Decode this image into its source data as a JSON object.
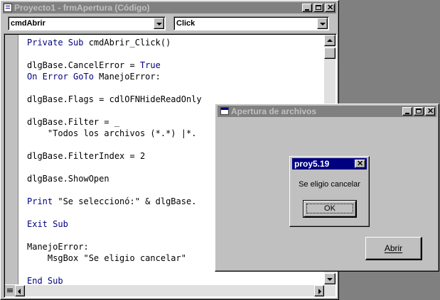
{
  "editor": {
    "title": "Proyecto1 - frmApertura (Código)",
    "object_combo": "cmdAbrir",
    "proc_combo": "Click",
    "lines": [
      [
        {
          "k": "kw",
          "t": "Private Sub "
        },
        {
          "k": "tx",
          "t": "cmdAbrir_Click()"
        }
      ],
      [],
      [
        {
          "k": "tx",
          "t": "dlgBase.CancelError = "
        },
        {
          "k": "kw",
          "t": "True"
        }
      ],
      [
        {
          "k": "kw",
          "t": "On Error GoTo "
        },
        {
          "k": "tx",
          "t": "ManejoError:"
        }
      ],
      [],
      [
        {
          "k": "tx",
          "t": "dlgBase.Flags = cdlOFNHideReadOnly"
        }
      ],
      [],
      [
        {
          "k": "tx",
          "t": "dlgBase.Filter = _"
        }
      ],
      [
        {
          "k": "tx",
          "t": "    \"Todos los archivos (*.*) |*."
        }
      ],
      [],
      [
        {
          "k": "tx",
          "t": "dlgBase.FilterIndex = 2"
        }
      ],
      [],
      [
        {
          "k": "tx",
          "t": "dlgBase.ShowOpen"
        }
      ],
      [],
      [
        {
          "k": "kw",
          "t": "Print "
        },
        {
          "k": "tx",
          "t": "\"Se seleccionó:\" & dlgBase."
        }
      ],
      [],
      [
        {
          "k": "kw",
          "t": "Exit Sub"
        }
      ],
      [],
      [
        {
          "k": "tx",
          "t": "ManejoError:"
        }
      ],
      [
        {
          "k": "tx",
          "t": "    MsgBox \"Se eligio cancelar\""
        }
      ],
      [],
      [
        {
          "k": "kw",
          "t": "End Sub"
        }
      ]
    ]
  },
  "form": {
    "title": "Apertura de archivos",
    "button_label": "Abrir"
  },
  "msgbox": {
    "title": "proy5.19",
    "message": "Se eligio cancelar",
    "ok_label": "OK"
  },
  "colors": {
    "keyword": "#000080",
    "active_title": "#000080",
    "inactive_title": "#808080",
    "face": "#c0c0c0"
  }
}
